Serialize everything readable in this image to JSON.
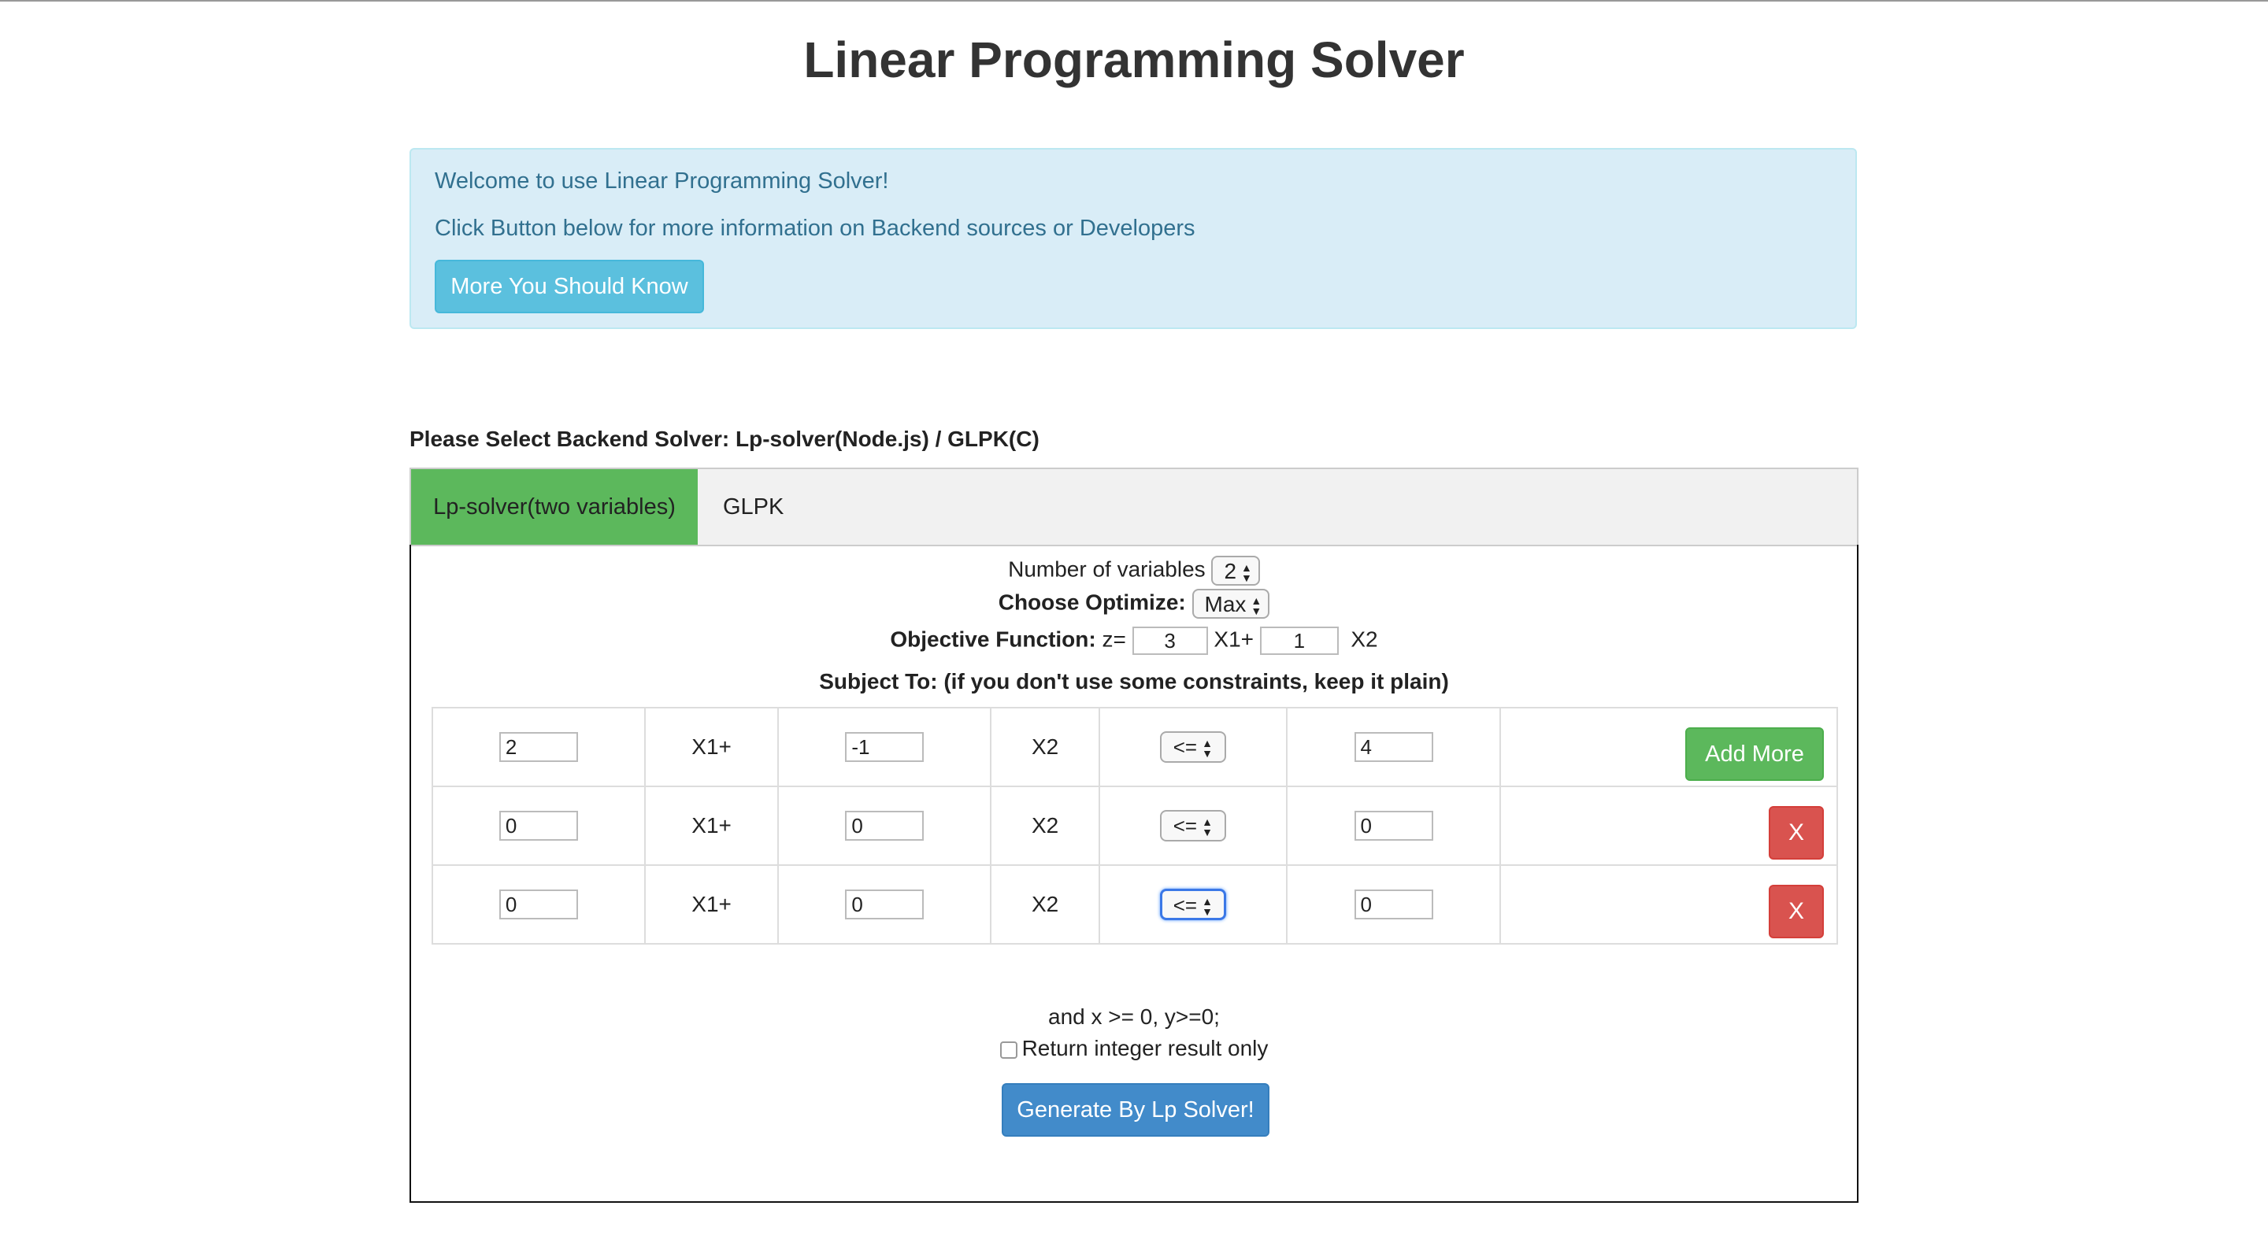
{
  "page": {
    "title": "Linear Programming Solver"
  },
  "alert": {
    "welcome": "Welcome to use Linear Programming Solver!",
    "info": "Click Button below for more information on Backend sources or Developers",
    "button": "More You Should Know"
  },
  "solver_select": {
    "label": "Please Select Backend Solver: Lp-solver(Node.js) / GLPK(C)",
    "tabs": [
      {
        "label": "Lp-solver(two variables)",
        "active": true
      },
      {
        "label": "GLPK",
        "active": false
      }
    ]
  },
  "form": {
    "num_vars_label": "Number of variables",
    "num_vars_value": "2",
    "optimize_label": "Choose Optimize:",
    "optimize_value": "Max",
    "objective_label": "Objective Function:",
    "objective_prefix": "z=",
    "objective_x1_coef": "3",
    "objective_x1_suffix": "X1+",
    "objective_x2_coef": "1",
    "objective_x2_suffix": "X2",
    "subject_to": "Subject To: (if you don't use some constraints, keep it plain)",
    "constraints": [
      {
        "a": "2",
        "x1": "X1+",
        "b": "-1",
        "x2": "X2",
        "op": "<=",
        "rhs": "4",
        "action": "Add More"
      },
      {
        "a": "0",
        "x1": "X1+",
        "b": "0",
        "x2": "X2",
        "op": "<=",
        "rhs": "0",
        "action": "X"
      },
      {
        "a": "0",
        "x1": "X1+",
        "b": "0",
        "x2": "X2",
        "op": "<=",
        "rhs": "0",
        "action": "X"
      }
    ],
    "nonneg": "and x >= 0, y>=0;",
    "integer_label": "Return integer result only",
    "generate_button": "Generate By Lp Solver!"
  },
  "colors": {
    "success": "#5cb85c",
    "danger": "#d9534f",
    "primary": "#428bca",
    "info": "#5bc0de",
    "alert_bg": "#d9edf7"
  }
}
